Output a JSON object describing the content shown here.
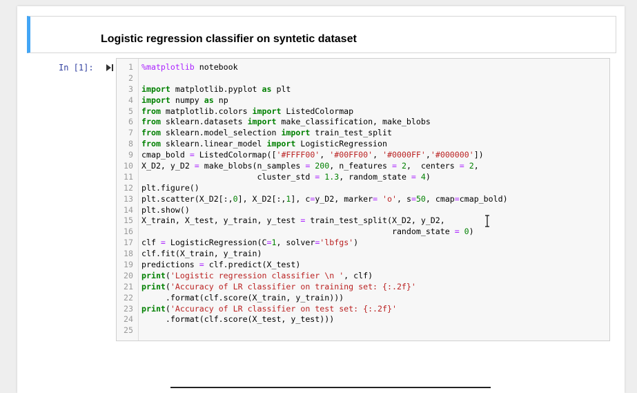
{
  "markdown_cell": {
    "title": "Logistic regression classifier on syntetic dataset"
  },
  "code_cell": {
    "prompt": "In [1]:",
    "lines": [
      {
        "n": "1",
        "tokens": [
          [
            "mg",
            "%matplotlib"
          ],
          [
            "",
            "notebook"
          ]
        ]
      },
      {
        "n": "2",
        "tokens": []
      },
      {
        "n": "3",
        "tokens": [
          [
            "kw",
            "import"
          ],
          [
            "",
            " matplotlib.pyplot "
          ],
          [
            "kw",
            "as"
          ],
          [
            "",
            " plt"
          ]
        ]
      },
      {
        "n": "4",
        "tokens": [
          [
            "kw",
            "import"
          ],
          [
            "",
            " numpy "
          ],
          [
            "kw",
            "as"
          ],
          [
            "",
            " np"
          ]
        ]
      },
      {
        "n": "5",
        "tokens": [
          [
            "kw",
            "from"
          ],
          [
            "",
            " matplotlib.colors "
          ],
          [
            "kw",
            "import"
          ],
          [
            "",
            " ListedColormap"
          ]
        ]
      },
      {
        "n": "6",
        "tokens": [
          [
            "kw",
            "from"
          ],
          [
            "",
            " sklearn.datasets "
          ],
          [
            "kw",
            "import"
          ],
          [
            "",
            " make_classification, make_blobs"
          ]
        ]
      },
      {
        "n": "7",
        "tokens": [
          [
            "kw",
            "from"
          ],
          [
            "",
            " sklearn.model_selection "
          ],
          [
            "kw",
            "import"
          ],
          [
            "",
            " train_test_split"
          ]
        ]
      },
      {
        "n": "8",
        "tokens": [
          [
            "kw",
            "from"
          ],
          [
            "",
            " sklearn.linear_model "
          ],
          [
            "kw",
            "import"
          ],
          [
            "",
            " LogisticRegression"
          ]
        ]
      },
      {
        "n": "9",
        "tokens": [
          [
            "",
            "cmap_bold "
          ],
          [
            "op",
            "="
          ],
          [
            "",
            " ListedColormap(["
          ],
          [
            "str",
            "'#FFFF00'"
          ],
          [
            "",
            ", "
          ],
          [
            "str",
            "'#00FF00'"
          ],
          [
            "",
            ", "
          ],
          [
            "str",
            "'#0000FF'"
          ],
          [
            "",
            ","
          ],
          [
            "str",
            "'#000000'"
          ],
          [
            "",
            "])"
          ]
        ]
      },
      {
        "n": "10",
        "tokens": [
          [
            "",
            "X_D2, y_D2 "
          ],
          [
            "op",
            "="
          ],
          [
            "",
            " make_blobs(n_samples "
          ],
          [
            "op",
            "="
          ],
          [
            "",
            " "
          ],
          [
            "num",
            "200"
          ],
          [
            "",
            ", n_features "
          ],
          [
            "op",
            "="
          ],
          [
            "",
            " "
          ],
          [
            "num",
            "2"
          ],
          [
            "",
            ",  centers "
          ],
          [
            "op",
            "="
          ],
          [
            "",
            " "
          ],
          [
            "num",
            "2"
          ],
          [
            "",
            ","
          ]
        ]
      },
      {
        "n": "11",
        "tokens": [
          [
            "",
            "                        cluster_std "
          ],
          [
            "op",
            "="
          ],
          [
            "",
            " "
          ],
          [
            "num",
            "1.3"
          ],
          [
            "",
            ", random_state "
          ],
          [
            "op",
            "="
          ],
          [
            "",
            " "
          ],
          [
            "num",
            "4"
          ],
          [
            "",
            ")"
          ]
        ]
      },
      {
        "n": "12",
        "tokens": [
          [
            "",
            "plt.figure()"
          ]
        ]
      },
      {
        "n": "13",
        "tokens": [
          [
            "",
            "plt.scatter(X_D2[:,"
          ],
          [
            "num",
            "0"
          ],
          [
            "",
            "], X_D2[:,"
          ],
          [
            "num",
            "1"
          ],
          [
            "",
            "], c"
          ],
          [
            "op",
            "="
          ],
          [
            "",
            "y_D2, marker"
          ],
          [
            "op",
            "="
          ],
          [
            "",
            " "
          ],
          [
            "str",
            "'o'"
          ],
          [
            "",
            ", s"
          ],
          [
            "op",
            "="
          ],
          [
            "num",
            "50"
          ],
          [
            "",
            ", cmap"
          ],
          [
            "op",
            "="
          ],
          [
            "",
            "cmap_bold)"
          ]
        ]
      },
      {
        "n": "14",
        "tokens": [
          [
            "",
            "plt.show()"
          ]
        ]
      },
      {
        "n": "15",
        "tokens": [
          [
            "",
            "X_train, X_test, y_train, y_test "
          ],
          [
            "op",
            "="
          ],
          [
            "",
            " train_test_split(X_D2, y_D2,"
          ]
        ]
      },
      {
        "n": "16",
        "tokens": [
          [
            "",
            "                                                    random_state "
          ],
          [
            "op",
            "="
          ],
          [
            "",
            " "
          ],
          [
            "num",
            "0"
          ],
          [
            "",
            ")"
          ]
        ]
      },
      {
        "n": "17",
        "tokens": [
          [
            "",
            "clf "
          ],
          [
            "op",
            "="
          ],
          [
            "",
            " LogisticRegression(C"
          ],
          [
            "op",
            "="
          ],
          [
            "num",
            "1"
          ],
          [
            "",
            ", solver"
          ],
          [
            "op",
            "="
          ],
          [
            "str",
            "'lbfgs'"
          ],
          [
            "",
            ")"
          ]
        ]
      },
      {
        "n": "18",
        "tokens": [
          [
            "",
            "clf.fit(X_train, y_train)"
          ]
        ]
      },
      {
        "n": "19",
        "tokens": [
          [
            "",
            "predictions "
          ],
          [
            "op",
            "="
          ],
          [
            "",
            " clf.predict(X_test)"
          ]
        ]
      },
      {
        "n": "20",
        "tokens": [
          [
            "kw",
            "print"
          ],
          [
            "",
            "("
          ],
          [
            "str",
            "'Logistic regression classifier \\n '"
          ],
          [
            "",
            ", clf)"
          ]
        ]
      },
      {
        "n": "21",
        "tokens": [
          [
            "kw",
            "print"
          ],
          [
            "",
            "("
          ],
          [
            "str",
            "'Accuracy of LR classifier on training set: {:.2f}'"
          ]
        ]
      },
      {
        "n": "22",
        "tokens": [
          [
            "",
            "     .format(clf.score(X_train, y_train)))"
          ]
        ]
      },
      {
        "n": "23",
        "tokens": [
          [
            "kw",
            "print"
          ],
          [
            "",
            "("
          ],
          [
            "str",
            "'Accuracy of LR classifier on test set: {:.2f}'"
          ]
        ]
      },
      {
        "n": "24",
        "tokens": [
          [
            "",
            "     .format(clf.score(X_test, y_test)))"
          ]
        ]
      },
      {
        "n": "25",
        "tokens": []
      }
    ]
  },
  "colors": {
    "accent": "#42a5f5",
    "prompt": "#303f9f"
  }
}
